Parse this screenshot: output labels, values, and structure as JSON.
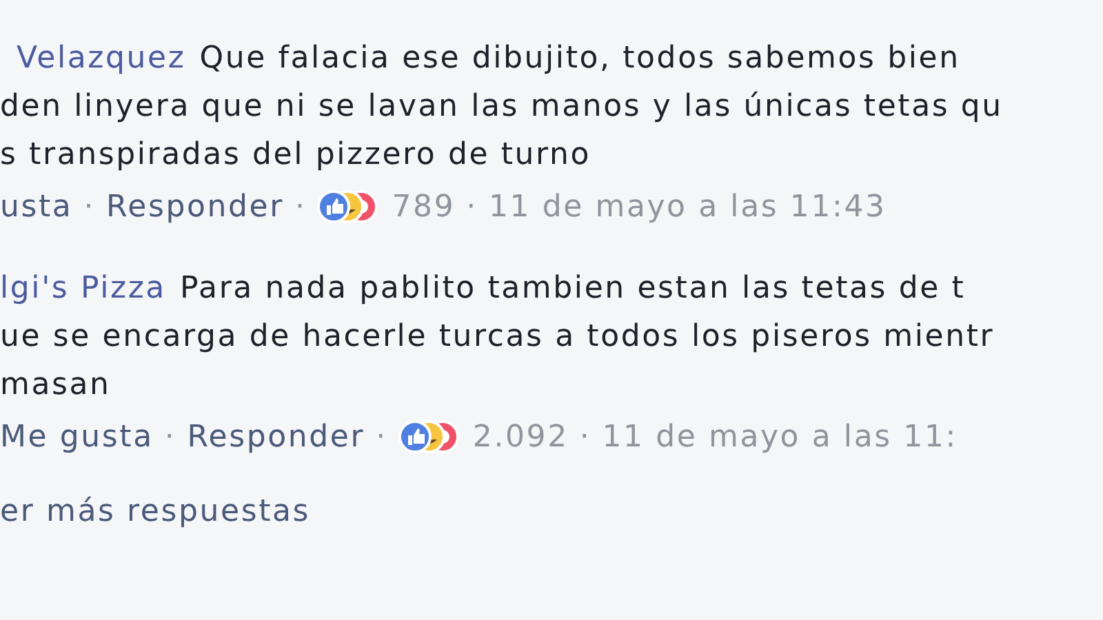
{
  "comments": [
    {
      "author": "Velazquez",
      "lines": [
        "Que falacia ese dibujito, todos sabemos bien",
        "den linyera que ni se lavan las manos y las únicas tetas qu",
        "s transpiradas del pizzero de turno"
      ],
      "like": "usta",
      "reply": "Responder",
      "reactions": "789",
      "time": "11 de mayo a las 11:43",
      "separators": [
        "·",
        "·",
        "·"
      ]
    },
    {
      "author": "lgi's Pizza",
      "lines": [
        "Para nada pablito tambien estan las tetas de t",
        "ue se encarga de hacerle turcas a todos los piseros mientr",
        "masan"
      ],
      "like": "Me gusta",
      "reply": "Responder",
      "reactions": "2.092",
      "time": "11 de mayo a las 11:",
      "separators": [
        "·",
        "·",
        "·"
      ]
    }
  ],
  "more_replies": "er más respuestas"
}
